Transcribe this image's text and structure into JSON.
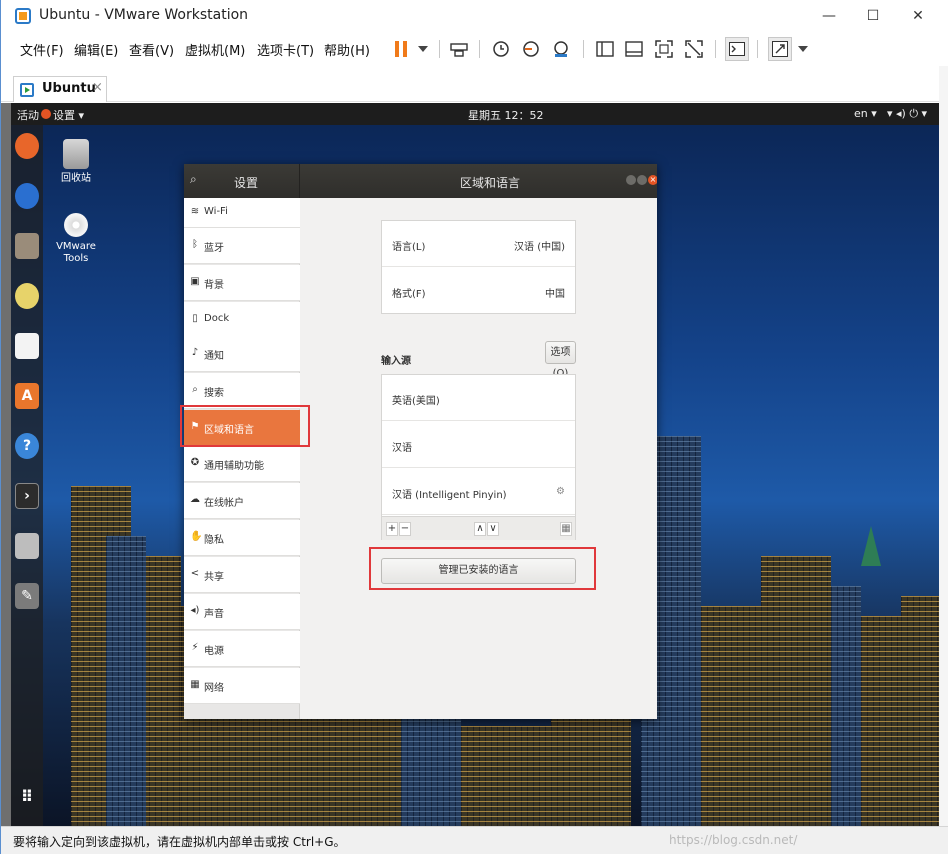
{
  "window": {
    "title": "Ubuntu - VMware Workstation",
    "controls": {
      "minimize": "—",
      "maximize": "☐",
      "close": "✕"
    }
  },
  "menubar": {
    "items": [
      "文件(F)",
      "编辑(E)",
      "查看(V)",
      "虚拟机(M)",
      "选项卡(T)",
      "帮助(H)"
    ]
  },
  "toolbar": {
    "icons": [
      "pause-icon",
      "dropdown-icon",
      "send-keys-icon",
      "snapshot-icon",
      "revert-snapshot-icon",
      "snapshot-manager-icon",
      "sidebar-toggle-icon",
      "thumbnail-icon",
      "fullscreen-icon",
      "unity-icon",
      "console-icon",
      "stretch-icon",
      "dropdown-icon"
    ]
  },
  "tab": {
    "label": "Ubuntu",
    "close": "×"
  },
  "guest": {
    "topbar": {
      "activities": "活动",
      "app_menu": "设置 ▾",
      "clock": "星期五 12：52",
      "input_method": "en ▾",
      "system_icons": "▾ ◂) ⏻ ▾"
    },
    "desktop_icons": [
      {
        "label": "回收站",
        "icon": "trash-icon"
      },
      {
        "label": "VMware Tools",
        "icon": "dvd-icon"
      }
    ],
    "dock_icons": [
      "firefox-icon",
      "thunderbird-icon",
      "files-icon",
      "rhythmbox-icon",
      "writer-icon",
      "software-icon",
      "help-icon",
      "terminal-icon",
      "scanner-icon",
      "settings-icon",
      "apps-grid-icon"
    ]
  },
  "settings": {
    "sidebar_title": "设置",
    "panel_title": "区域和语言",
    "sidebar_items": [
      {
        "label": "Wi-Fi",
        "icon": "wifi-icon",
        "glyph": "≋"
      },
      {
        "label": "蓝牙",
        "icon": "bluetooth-icon",
        "glyph": "ᛒ"
      },
      {
        "label": "背景",
        "icon": "background-icon",
        "glyph": "▣"
      },
      {
        "label": "Dock",
        "icon": "dock-icon",
        "glyph": "▯"
      },
      {
        "label": "通知",
        "icon": "bell-icon",
        "glyph": "♪"
      },
      {
        "label": "搜索",
        "icon": "search-icon",
        "glyph": "⌕"
      },
      {
        "label": "区域和语言",
        "icon": "region-icon",
        "glyph": "⚑"
      },
      {
        "label": "通用辅助功能",
        "icon": "accessibility-icon",
        "glyph": "✪"
      },
      {
        "label": "在线帐户",
        "icon": "online-accounts-icon",
        "glyph": "☁"
      },
      {
        "label": "隐私",
        "icon": "privacy-icon",
        "glyph": "✋"
      },
      {
        "label": "共享",
        "icon": "share-icon",
        "glyph": "<"
      },
      {
        "label": "声音",
        "icon": "sound-icon",
        "glyph": "◂)"
      },
      {
        "label": "电源",
        "icon": "power-icon",
        "glyph": "⚡"
      },
      {
        "label": "网络",
        "icon": "network-icon",
        "glyph": "▦"
      }
    ],
    "language": {
      "label": "语言(L)",
      "value": "汉语 (中国)"
    },
    "formats": {
      "label": "格式(F)",
      "value": "中国"
    },
    "input_sources": {
      "label": "输入源",
      "options_button": "选项(O)",
      "items": [
        "英语(美国)",
        "汉语",
        "汉语 (Intelligent Pinyin)"
      ],
      "add": "+",
      "remove": "−",
      "up": "∧",
      "down": "∨"
    },
    "manage_button": "管理已安装的语言"
  },
  "statusbar": {
    "text": "要将输入定向到该虚拟机，请在虚拟机内部单击或按 Ctrl+G。",
    "watermark": "https://blog.csdn.net/"
  },
  "colors": {
    "accent": "#e9763e",
    "highlight_box": "#e0383b",
    "vmware_blue": "#2b7ac7"
  }
}
